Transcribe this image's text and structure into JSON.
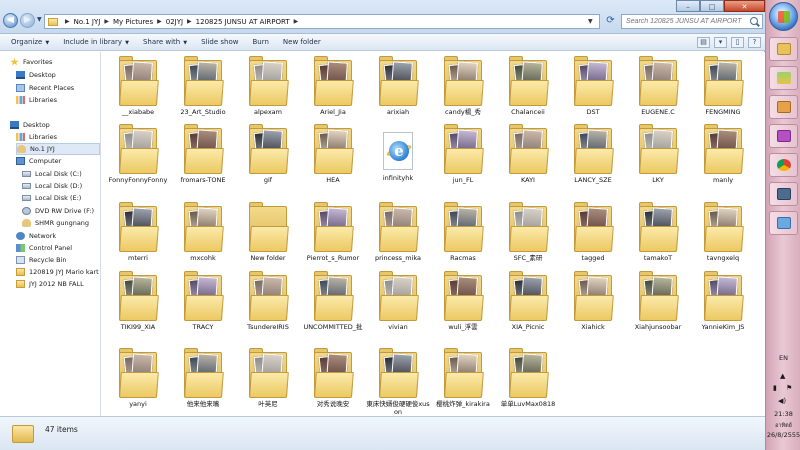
{
  "breadcrumbs": [
    "No.1 JYJ",
    "My Pictures",
    "02JYJ",
    "120825 JUNSU AT AIRPORT"
  ],
  "search": {
    "placeholder": "Search 120825 JUNSU AT AIRPORT"
  },
  "toolbar": {
    "organize": "Organize",
    "include_in_library": "Include in library",
    "share_with": "Share with",
    "slide_show": "Slide show",
    "burn": "Burn",
    "new_folder": "New folder"
  },
  "nav": {
    "favorites": "Favorites",
    "desktop_fav": "Desktop",
    "recent_places": "Recent Places",
    "libraries_fav": "Libraries",
    "desktop": "Desktop",
    "libraries": "Libraries",
    "user": "No.1 JYJ",
    "computer": "Computer",
    "drive_c": "Local Disk (C:)",
    "drive_d": "Local Disk (D:)",
    "drive_e": "Local Disk (E:)",
    "dvd": "DVD RW Drive (F:)",
    "shmr": "SHMR gungnang",
    "network": "Network",
    "control_panel": "Control Panel",
    "recycle_bin": "Recycle Bin",
    "folder_mario": "120819 JYJ Mario kart",
    "folder_nb": "JYJ 2012 NB FALL"
  },
  "items": [
    "__xiababe",
    "23_Art_Studio",
    "alpexam",
    "Ariel_Jia",
    "arixiah",
    "candy楊_秀",
    "Chalanceii",
    "DST",
    "EUGENE.C",
    "FENGMING",
    "FonnyFonnyFonny",
    "fromars-TONE",
    "gif",
    "HEA",
    "infinityhk",
    "jun_FL",
    "KAYI",
    "LANCY_SZE",
    "LKY",
    "manly",
    "mterri",
    "mxcohk",
    "New folder",
    "Pierrot_s_Rumor",
    "princess_mika",
    "Racmas",
    "SFC_素研",
    "tagged",
    "tamakoT",
    "tavngxelq",
    "TIKI99_XIA",
    "TRACY",
    "TsundereIRIS",
    "UNCOMMITTED_批",
    "vivian",
    "wuli_浮雲",
    "XIA_Picnic",
    "Xiahick",
    "Xiahjunsoobar",
    "YannieKim_JS",
    "yanyi",
    "他来他来嘴",
    "叶英尼",
    "对秀说晚安",
    "東床快婿俊硬硬俊xuson",
    "樱桃炸弹_kirakira",
    "单单LuvMax0818"
  ],
  "status": {
    "count": "47 items"
  },
  "tray": {
    "lang": "EN",
    "time": "21:38",
    "day": "อาทิตย์",
    "date": "26/8/2555"
  },
  "colors": {
    "folder": "#f3d98b",
    "taskbar": "#e9c9d3",
    "accent": "#3a79c6"
  }
}
